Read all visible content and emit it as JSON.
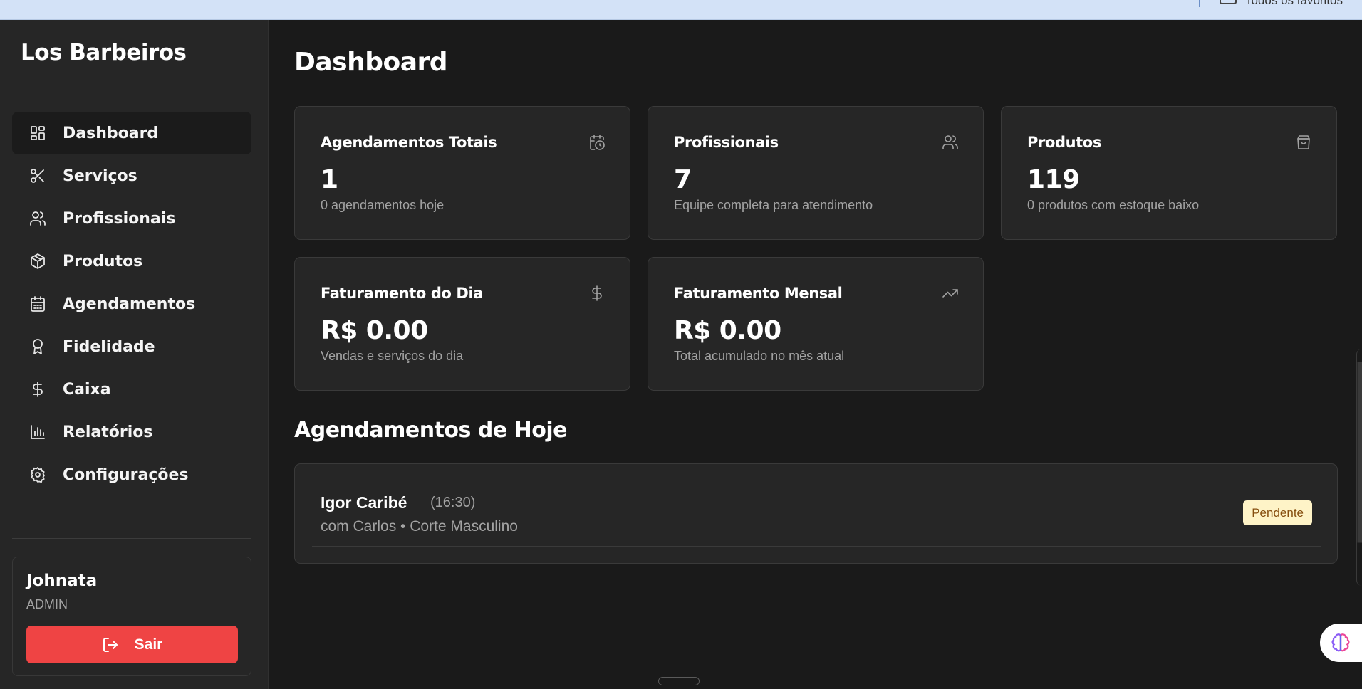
{
  "browser": {
    "favorites_label": "Todos os favoritos"
  },
  "sidebar": {
    "brand": "Los Barbeiros",
    "items": [
      {
        "label": "Dashboard",
        "icon": "dashboard-icon",
        "active": true
      },
      {
        "label": "Serviços",
        "icon": "scissors-icon",
        "active": false
      },
      {
        "label": "Profissionais",
        "icon": "users-icon",
        "active": false
      },
      {
        "label": "Produtos",
        "icon": "package-icon",
        "active": false
      },
      {
        "label": "Agendamentos",
        "icon": "calendar-icon",
        "active": false
      },
      {
        "label": "Fidelidade",
        "icon": "award-icon",
        "active": false
      },
      {
        "label": "Caixa",
        "icon": "dollar-icon",
        "active": false
      },
      {
        "label": "Relatórios",
        "icon": "bar-chart-icon",
        "active": false
      },
      {
        "label": "Configurações",
        "icon": "settings-icon",
        "active": false
      }
    ],
    "user": {
      "name": "Johnata",
      "role": "ADMIN",
      "logout_label": "Sair"
    }
  },
  "main": {
    "title": "Dashboard",
    "cards": [
      {
        "title": "Agendamentos Totais",
        "value": "1",
        "desc": "0 agendamentos hoje",
        "icon": "calendar-clock-icon"
      },
      {
        "title": "Profissionais",
        "value": "7",
        "desc": "Equipe completa para atendimento",
        "icon": "users-icon"
      },
      {
        "title": "Produtos",
        "value": "119",
        "desc": "0 produtos com estoque baixo",
        "icon": "shopping-bag-icon"
      },
      {
        "title": "Faturamento do Dia",
        "value": "R$ 0.00",
        "desc": "Vendas e serviços do dia",
        "icon": "dollar-icon"
      },
      {
        "title": "Faturamento Mensal",
        "value": "R$ 0.00",
        "desc": "Total acumulado no mês atual",
        "icon": "trending-up-icon"
      }
    ],
    "today_section_title": "Agendamentos de Hoje",
    "appointments": [
      {
        "client": "Igor Caribé",
        "time": "(16:30)",
        "detail": "com Carlos • Corte Masculino",
        "status": "Pendente"
      }
    ]
  },
  "colors": {
    "background": "#1a1a1a",
    "sidebar": "#262626",
    "card": "#262626",
    "logout": "#ef4444",
    "badge_bg": "#fef3c7",
    "badge_text": "#854d0e"
  }
}
